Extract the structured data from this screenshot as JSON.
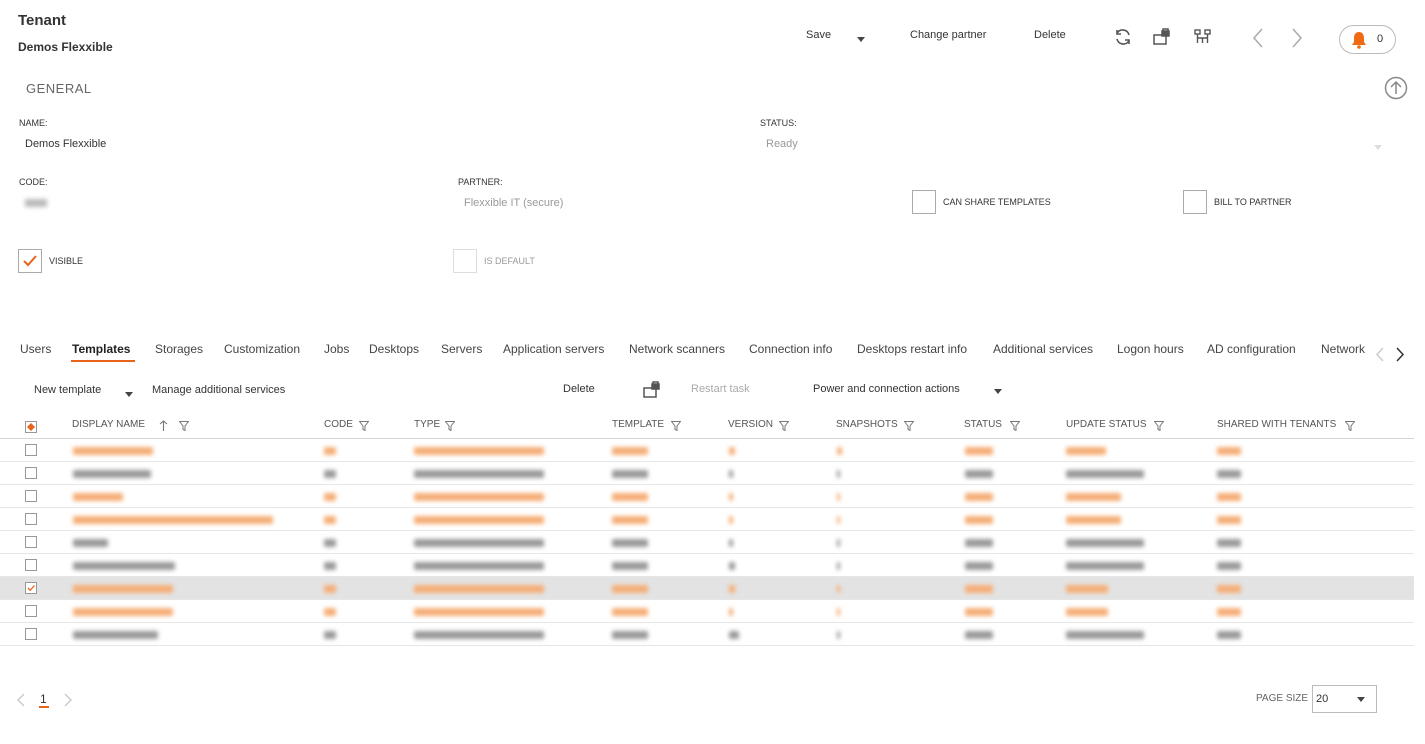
{
  "header": {
    "title": "Tenant",
    "subtitle": "Demos Flexxible"
  },
  "toolbar": {
    "save": "Save",
    "change_partner": "Change partner",
    "delete": "Delete",
    "notifications_count": "0"
  },
  "section_title": "GENERAL",
  "form": {
    "name_label": "NAME:",
    "name_value": "Demos Flexxible",
    "status_label": "STATUS:",
    "status_value": "Ready",
    "code_label": "CODE:",
    "partner_label": "PARTNER:",
    "partner_value": "Flexxible IT (secure)",
    "can_share_templates": "CAN SHARE TEMPLATES",
    "bill_to_partner": "BILL TO PARTNER",
    "visible": "VISIBLE",
    "is_default": "IS DEFAULT"
  },
  "tabs": [
    "Users",
    "Templates",
    "Storages",
    "Customization",
    "Jobs",
    "Desktops",
    "Servers",
    "Application servers",
    "Network scanners",
    "Connection info",
    "Desktops restart info",
    "Additional services",
    "Logon hours",
    "AD configuration",
    "Network"
  ],
  "actions": {
    "new_template": "New template",
    "manage_additional_services": "Manage additional services",
    "delete": "Delete",
    "restart_task": "Restart task",
    "power_actions": "Power and connection actions"
  },
  "table": {
    "columns": [
      "DISPLAY NAME",
      "CODE",
      "TYPE",
      "TEMPLATE",
      "VERSION",
      "SNAPSHOTS",
      "STATUS",
      "UPDATE STATUS",
      "SHARED WITH TENANTS"
    ],
    "rows": [
      {
        "highlight": true,
        "selected": false
      },
      {
        "highlight": false,
        "selected": false
      },
      {
        "highlight": true,
        "selected": false
      },
      {
        "highlight": true,
        "selected": false
      },
      {
        "highlight": false,
        "selected": false
      },
      {
        "highlight": false,
        "selected": false
      },
      {
        "highlight": true,
        "selected": true
      },
      {
        "highlight": true,
        "selected": false
      },
      {
        "highlight": false,
        "selected": false
      }
    ]
  },
  "pagination": {
    "current_page": "1",
    "page_size_label": "PAGE SIZE",
    "page_size": "20"
  },
  "colors": {
    "accent": "#e8641b",
    "bell": "#f06a14",
    "blurred_gray": "#9a9a9a",
    "blurred_orange": "#f5ae77"
  },
  "icons": [
    "caret-down-icon",
    "refresh-icon",
    "lock-monitor-icon",
    "network-icon",
    "chevron-left-icon",
    "chevron-right-icon",
    "bell-icon",
    "arrow-up-circle-icon",
    "sort-up-icon",
    "filter-icon"
  ]
}
